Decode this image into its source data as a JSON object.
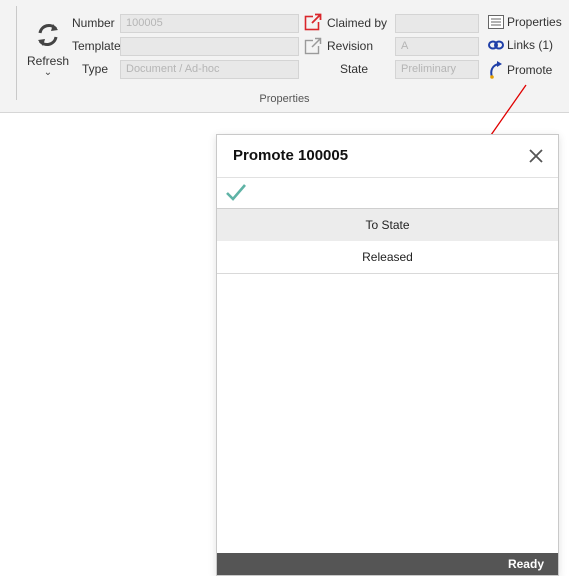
{
  "ribbon": {
    "refresh_label": "Refresh",
    "refresh_chevron": "⌄",
    "number_label": "Number",
    "number_value": "100005",
    "template_label": "Template",
    "template_value": "",
    "type_label": "Type",
    "type_value": "Document / Ad-hoc",
    "claimed_by_label": "Claimed by",
    "claimed_by_value": "",
    "revision_label": "Revision",
    "revision_value": "A",
    "state_label": "State",
    "state_value": "Preliminary",
    "properties_button": "Properties",
    "links_button": "Links (1)",
    "promote_button": "Promote",
    "group_label": "Properties"
  },
  "dialog": {
    "title": "Promote 100005",
    "column_header": "To State",
    "rows": [
      "Released"
    ],
    "status": "Ready"
  },
  "colors": {
    "checkmark": "#5fb3a6",
    "arrow": "#e00000",
    "status_bar": "#555555",
    "ribbon_bg": "#f3f3f3"
  },
  "icons": {
    "refresh": "refresh-icon",
    "claim": "open-external-red-icon",
    "revision": "open-external-gray-icon",
    "properties": "properties-icon",
    "links": "link-icon",
    "promote": "promote-icon",
    "close": "close-icon",
    "apply": "checkmark-icon"
  }
}
